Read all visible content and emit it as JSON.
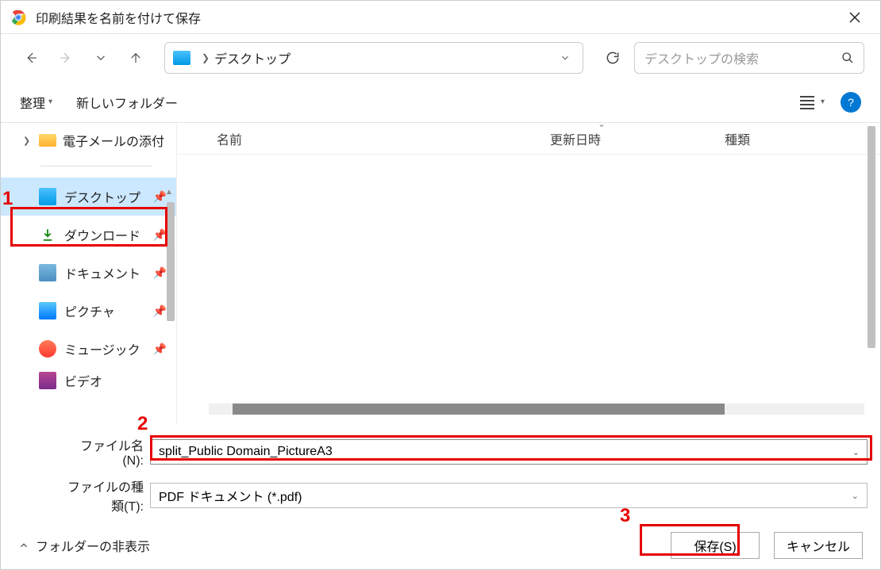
{
  "titlebar": {
    "title": "印刷結果を名前を付けて保存"
  },
  "addressbar": {
    "location": "デスクトップ"
  },
  "searchbox": {
    "placeholder": "デスクトップの検索"
  },
  "toolbar": {
    "organize": "整理",
    "newfolder": "新しいフォルダー"
  },
  "sidebar": {
    "tree_email": "電子メールの添付",
    "items": [
      {
        "label": "デスクトップ"
      },
      {
        "label": "ダウンロード"
      },
      {
        "label": "ドキュメント"
      },
      {
        "label": "ピクチャ"
      },
      {
        "label": "ミュージック"
      },
      {
        "label": "ビデオ"
      }
    ]
  },
  "columns": {
    "name": "名前",
    "date": "更新日時",
    "type": "種類"
  },
  "fields": {
    "filename_label": "ファイル名(N):",
    "filename_value": "split_Public Domain_PictureA3",
    "filetype_label": "ファイルの種類(T):",
    "filetype_value": "PDF ドキュメント (*.pdf)"
  },
  "footer": {
    "hide_folders": "フォルダーの非表示",
    "save": "保存(S)",
    "cancel": "キャンセル"
  },
  "annotations": {
    "a1": "1",
    "a2": "2",
    "a3": "3"
  }
}
